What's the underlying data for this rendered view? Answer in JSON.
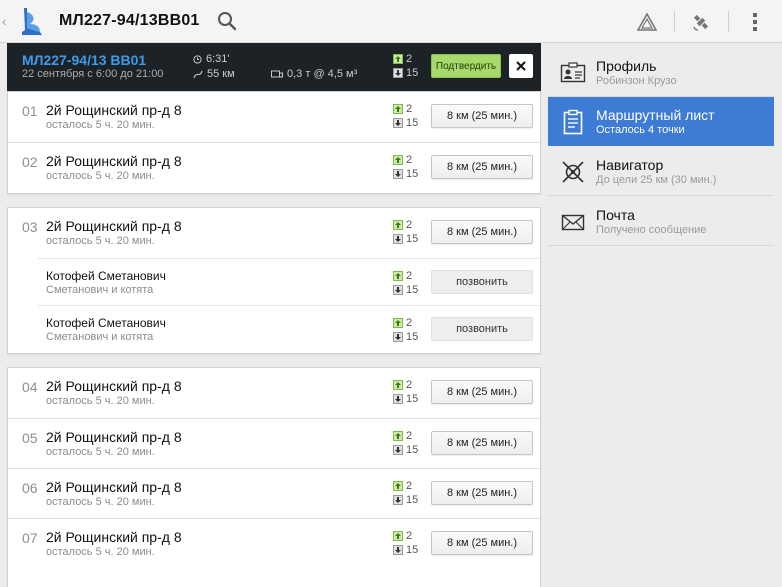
{
  "app": {
    "title": "МЛ227-94/13BB01"
  },
  "header": {
    "route": "МЛ227-94/13 BB01",
    "date": "22 сентября с 6:00 до 21:00",
    "time": "6:31'",
    "distance": "55 км",
    "cargo": "0,3 т @ 4,5 м³",
    "load_count": "2",
    "unload_count": "15",
    "confirm_label": "Подтвердить"
  },
  "groups": [
    {
      "rows": [
        {
          "num": "01",
          "address": "2й Рощинский пр-д 8",
          "remaining": "осталось 5 ч. 20 мин.",
          "load": "2",
          "unload": "15",
          "action": "8 км (25 мин.)"
        },
        {
          "num": "02",
          "address": "2й Рощинский пр-д 8",
          "remaining": "осталось 5 ч. 20 мин.",
          "load": "2",
          "unload": "15",
          "action": "8 км (25 мин.)"
        }
      ]
    },
    {
      "rows": [
        {
          "num": "03",
          "address": "2й Рощинский пр-д 8",
          "remaining": "осталось 5 ч. 20 мин.",
          "load": "2",
          "unload": "15",
          "action": "8 км (25 мин.)"
        }
      ],
      "contacts": [
        {
          "name": "Котофей Сметанович",
          "org": "Сметанович и котята",
          "load": "2",
          "unload": "15",
          "action": "позвонить"
        },
        {
          "name": "Котофей Сметанович",
          "org": "Сметанович и котята",
          "load": "2",
          "unload": "15",
          "action": "позвонить"
        }
      ]
    },
    {
      "rows": [
        {
          "num": "04",
          "address": "2й Рощинский пр-д 8",
          "remaining": "осталось 5 ч. 20 мин.",
          "load": "2",
          "unload": "15",
          "action": "8 км (25 мин.)"
        },
        {
          "num": "05",
          "address": "2й Рощинский пр-д 8",
          "remaining": "осталось 5 ч. 20 мин.",
          "load": "2",
          "unload": "15",
          "action": "8 км (25 мин.)"
        },
        {
          "num": "06",
          "address": "2й Рощинский пр-д 8",
          "remaining": "осталось 5 ч. 20 мин.",
          "load": "2",
          "unload": "15",
          "action": "8 км (25 мин.)"
        },
        {
          "num": "07",
          "address": "2й Рощинский пр-д 8",
          "remaining": "осталось 5 ч. 20 мин.",
          "load": "2",
          "unload": "15",
          "action": "8 км (25 мин.)"
        }
      ]
    }
  ],
  "nav": [
    {
      "title": "Профиль",
      "subtitle": "Робинзон Крузо",
      "icon": "id-card-icon",
      "active": false
    },
    {
      "title": "Маршрутный лист",
      "subtitle": "Осталось 4 точки",
      "icon": "clipboard-icon",
      "active": true
    },
    {
      "title": "Навигатор",
      "subtitle": "До цели 25 км (30 мин.)",
      "icon": "compass-icon",
      "active": false
    },
    {
      "title": "Почта",
      "subtitle": "Получено сообщение",
      "icon": "envelope-icon",
      "active": false
    }
  ],
  "colors": {
    "accent": "#3d7bd4",
    "route_blue": "#3d9be9",
    "confirm_green": "#a8d96b",
    "header_dark": "#1d2226"
  }
}
